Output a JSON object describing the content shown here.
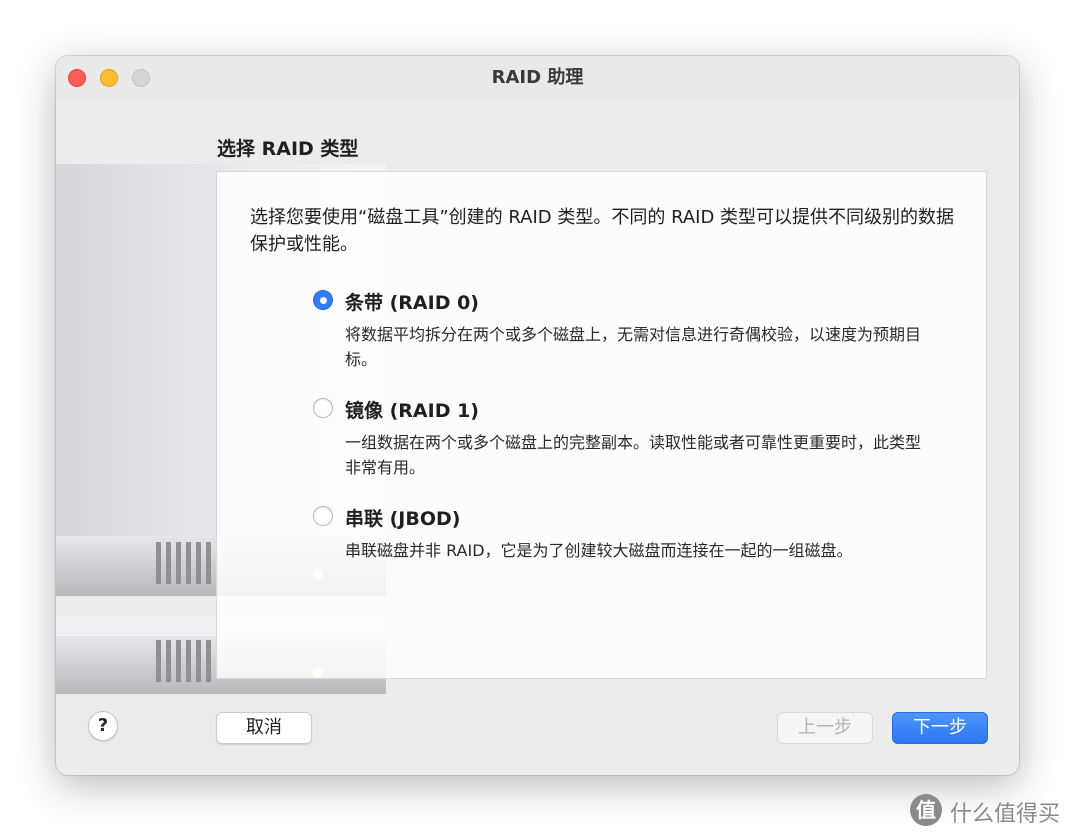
{
  "window": {
    "title": "RAID 助理"
  },
  "page": {
    "heading": "选择 RAID 类型",
    "intro": "选择您要使用“磁盘工具”创建的 RAID 类型。不同的 RAID 类型可以提供不同级别的数据保护或性能。"
  },
  "options": [
    {
      "title": "条带 (RAID 0)",
      "description": "将数据平均拆分在两个或多个磁盘上，无需对信息进行奇偶校验，以速度为预期目标。",
      "selected": true
    },
    {
      "title": "镜像 (RAID 1)",
      "description": "一组数据在两个或多个磁盘上的完整副本。读取性能或者可靠性更重要时，此类型非常有用。",
      "selected": false
    },
    {
      "title": "串联 (JBOD)",
      "description": "串联磁盘并非 RAID，它是为了创建较大磁盘而连接在一起的一组磁盘。",
      "selected": false
    }
  ],
  "footer": {
    "help_label": "?",
    "cancel_label": "取消",
    "back_label": "上一步",
    "next_label": "下一步"
  },
  "watermark": {
    "icon_text": "值",
    "text": "什么值得买"
  },
  "colors": {
    "accent": "#2f7cf6",
    "close": "#ff5f57",
    "minimize": "#febc2e",
    "zoom_disabled": "#d6d6d6"
  }
}
